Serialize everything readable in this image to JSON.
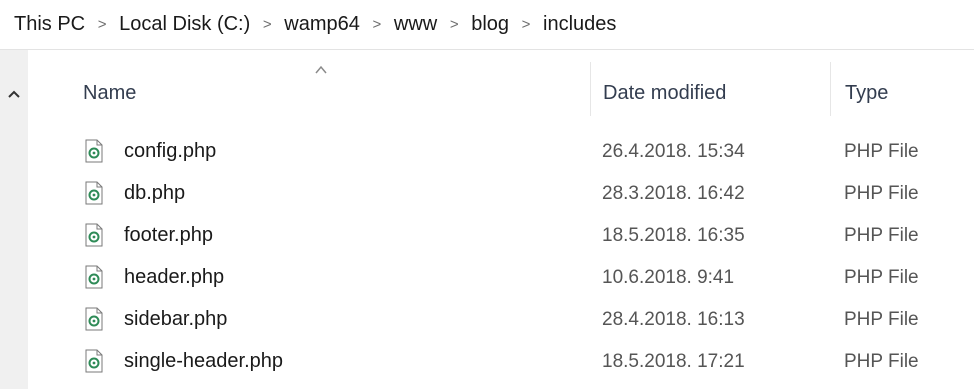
{
  "breadcrumb": {
    "items": [
      {
        "label": "This PC"
      },
      {
        "label": "Local Disk (C:)"
      },
      {
        "label": "wamp64"
      },
      {
        "label": "www"
      },
      {
        "label": "blog"
      },
      {
        "label": "includes"
      }
    ],
    "separator": ">"
  },
  "columns": {
    "name": "Name",
    "date": "Date modified",
    "type": "Type",
    "sort": "ascending"
  },
  "files": [
    {
      "name": "config.php",
      "date": "26.4.2018. 15:34",
      "type": "PHP File",
      "icon": "php-file-icon"
    },
    {
      "name": "db.php",
      "date": "28.3.2018. 16:42",
      "type": "PHP File",
      "icon": "php-file-icon"
    },
    {
      "name": "footer.php",
      "date": "18.5.2018. 16:35",
      "type": "PHP File",
      "icon": "php-file-icon"
    },
    {
      "name": "header.php",
      "date": "10.6.2018. 9:41",
      "type": "PHP File",
      "icon": "php-file-icon"
    },
    {
      "name": "sidebar.php",
      "date": "28.4.2018. 16:13",
      "type": "PHP File",
      "icon": "php-file-icon"
    },
    {
      "name": "single-header.php",
      "date": "18.5.2018. 17:21",
      "type": "PHP File",
      "icon": "php-file-icon"
    }
  ],
  "colors": {
    "header_text": "#333d4f",
    "scrollbar": "#f0f0f0",
    "icon_green": "#2e8b57"
  }
}
